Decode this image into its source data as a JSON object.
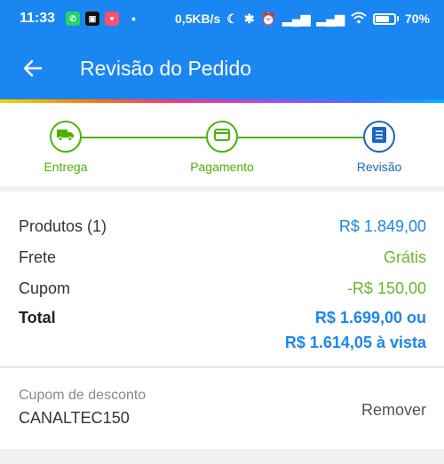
{
  "status_bar": {
    "time": "11:33",
    "network_speed": "0,5KB/s",
    "battery": "70%",
    "dot": "•",
    "icons": [
      "whatsapp-icon",
      "app-icon",
      "tinder-icon",
      "moon-icon",
      "bluetooth-icon",
      "alarm-icon",
      "signal-icon",
      "wifi-icon",
      "battery-icon"
    ]
  },
  "app_bar": {
    "title": "Revisão do Pedido",
    "back_icon": "arrow-left-icon"
  },
  "stepper": {
    "steps": [
      {
        "label": "Entrega",
        "icon": "truck-icon",
        "color": "#49b400"
      },
      {
        "label": "Pagamento",
        "icon": "card-icon",
        "color": "#49b400"
      },
      {
        "label": "Revisão",
        "icon": "list-icon",
        "color": "#1666c5"
      }
    ]
  },
  "summary": {
    "produtos_label": "Produtos (1)",
    "produtos_value": "R$ 1.849,00",
    "frete_label": "Frete",
    "frete_value": "Grátis",
    "cupom_label": "Cupom",
    "cupom_value": "-R$ 150,00",
    "total_label": "Total",
    "total_value_line1": "R$ 1.699,00 ou",
    "total_value_line2": "R$ 1.614,05 à vista"
  },
  "coupon": {
    "label": "Cupom de desconto",
    "code": "CANALTEC150",
    "remove_label": "Remover"
  },
  "colors": {
    "primary_blue": "#1a86f2",
    "step_green": "#49b400",
    "step_blue": "#1666c5",
    "price_green": "#6bb52d"
  }
}
